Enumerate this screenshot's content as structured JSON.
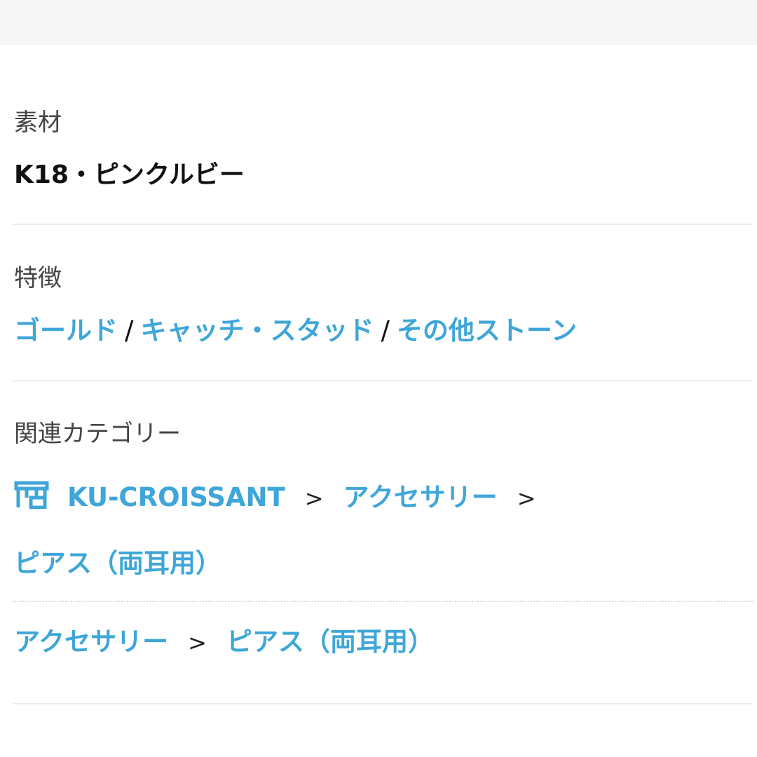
{
  "material": {
    "label": "素材",
    "value": "K18・ピンクルビー"
  },
  "features": {
    "label": "特徴",
    "separator": "/",
    "links": [
      "ゴールド",
      "キャッチ・スタッド",
      "その他ストーン"
    ]
  },
  "related": {
    "label": "関連カテゴリー",
    "chevron": ">",
    "shop_icon": "shop-icon",
    "brand_path": [
      "KU-CROISSANT",
      "アクセサリー",
      "ピアス（両耳用）"
    ],
    "category_path": [
      "アクセサリー",
      "ピアス（両耳用）"
    ]
  },
  "colors": {
    "link": "#3ea6d8",
    "divider": "#ececec"
  }
}
